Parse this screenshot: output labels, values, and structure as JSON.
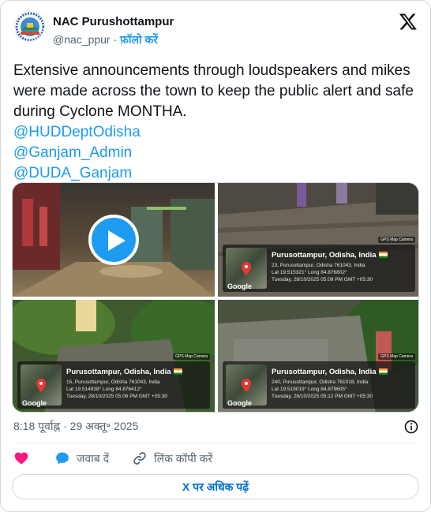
{
  "author": {
    "name": "NAC Purushottampur",
    "handle": "@nac_ppur",
    "separator": "·",
    "follow_label": "फ़ॉलो करें"
  },
  "tweet": {
    "text": "Extensive announcements through loudspeakers and mikes were made across the town to keep the public alert and safe during Cyclone MONTHA.",
    "mentions": [
      "@HUDDeptOdisha",
      "@Ganjam_Admin",
      "@DUDA_Ganjam"
    ]
  },
  "media": {
    "tiles": [
      {
        "kind": "video"
      },
      {
        "kind": "photo",
        "gps": {
          "badge": "GPS Map Camera",
          "title": "Purusottampur, Odisha, India",
          "line1": "23, Purusottampur, Odisha 761043, India",
          "line2": "Lat 19.515321° Long 84.876802°",
          "line3": "Tuesday, 28/10/2025 05:09 PM GMT +05:30",
          "google": "Google"
        }
      },
      {
        "kind": "photo",
        "gps": {
          "badge": "GPS Map Camera",
          "title": "Purusottampur, Odisha, India",
          "line1": "15, Purusottampur, Odisha 761043, India",
          "line2": "Lat 19.514938° Long 84.876412°",
          "line3": "Tuesday, 28/10/2025 05:06 PM GMT +05:30",
          "google": "Google"
        }
      },
      {
        "kind": "photo",
        "gps": {
          "badge": "GPS Map Camera",
          "title": "Purusottampur, Odisha, India",
          "line1": "240, Purusottampur, Odisha 761018, India",
          "line2": "Lat 19.519019° Long 84.879605°",
          "line3": "Tuesday, 28/10/2025 05:12 PM GMT +05:30",
          "google": "Google"
        }
      }
    ]
  },
  "meta": {
    "time": "8:18 पूर्वाह्न",
    "separator": "·",
    "date": "29 अक्तू॰ 2025"
  },
  "actions": {
    "reply_label": "जवाब दें",
    "copy_link_label": "लिंक कॉपी करें"
  },
  "read_more_label": "X पर अधिक पढ़ें",
  "colors": {
    "accent": "#1d9bf0",
    "like": "#f91880",
    "link_button": "#006fd6",
    "secondary_text": "#536471"
  }
}
